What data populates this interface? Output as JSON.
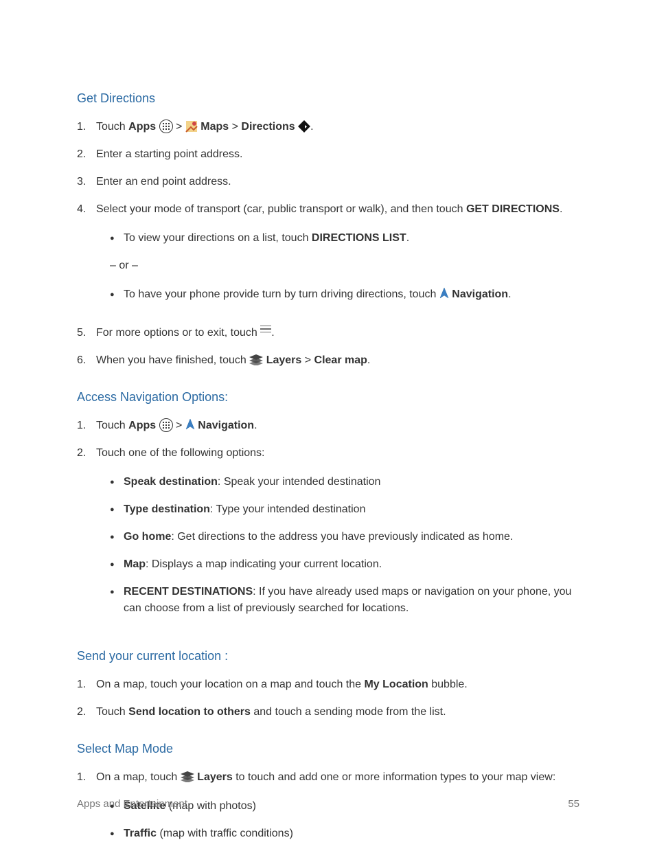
{
  "headings": {
    "get_directions": "Get Directions",
    "access_nav": "Access Navigation Options:",
    "send_location": "Send your current location :",
    "select_map_mode": "Select Map Mode"
  },
  "get_directions": {
    "step1": {
      "num": "1.",
      "touch": "Touch ",
      "apps": "Apps",
      "gt1": " > ",
      "maps": " Maps",
      "gt2": " > ",
      "directions": "Directions",
      "period": "."
    },
    "step2": {
      "num": "2.",
      "text": "Enter a starting point address."
    },
    "step3": {
      "num": "3.",
      "text": "Enter an end point address."
    },
    "step4": {
      "num": "4.",
      "lead": "Select your mode of transport (car, public transport or walk), and then touch ",
      "get_dir": "GET DIRECTIONS",
      "period": ".",
      "bullet1_lead": "To view your directions on a list, touch ",
      "bullet1_bold": "DIRECTIONS LIST",
      "bullet1_end": ".",
      "or": "– or –",
      "bullet2_lead": "To have your phone provide turn by turn driving directions, touch ",
      "bullet2_bold": " Navigation",
      "bullet2_end": "."
    },
    "step5": {
      "num": "5.",
      "lead": "For more options or to exit, touch ",
      "end": "."
    },
    "step6": {
      "num": "6.",
      "lead": "When you have finished, touch ",
      "layers": " Layers",
      "gt": " > ",
      "clear": "Clear map",
      "end": "."
    }
  },
  "access_nav": {
    "step1": {
      "num": "1.",
      "touch": "Touch ",
      "apps": "Apps",
      "gt": " > ",
      "nav": " Navigation",
      "end": "."
    },
    "step2": {
      "num": "2.",
      "lead": "Touch one of the following options:",
      "items": {
        "speak_b": "Speak destination",
        "speak_t": ": Speak your intended destination",
        "type_b": "Type destination",
        "type_t": ": Type your intended destination",
        "home_b": "Go home",
        "home_t": ": Get directions to the address you have previously indicated as home.",
        "map_b": "Map",
        "map_t": ": Displays a map indicating your current location.",
        "recent_b": "RECENT DESTINATIONS",
        "recent_t": ": If you have already used maps or navigation on your phone, you can choose from a list of previously searched for locations."
      }
    }
  },
  "send_location": {
    "step1": {
      "num": "1.",
      "lead": "On a map, touch your location on a map and touch the ",
      "bold": "My Location",
      "end": " bubble."
    },
    "step2": {
      "num": "2.",
      "lead": "Touch ",
      "bold": "Send location to others",
      "end": " and touch a sending mode from the list."
    }
  },
  "map_mode": {
    "step1": {
      "num": "1.",
      "lead1": "On a map, touch ",
      "layers": " Layers",
      "lead2": " to touch and add one or more information types to your map view:",
      "items": {
        "sat_b": "Satellite",
        "sat_t": " (map with photos)",
        "traf_b": "Traffic",
        "traf_t": " (map with traffic conditions)"
      }
    }
  },
  "footer": {
    "section": "Apps and Entertainment",
    "page": "55"
  }
}
